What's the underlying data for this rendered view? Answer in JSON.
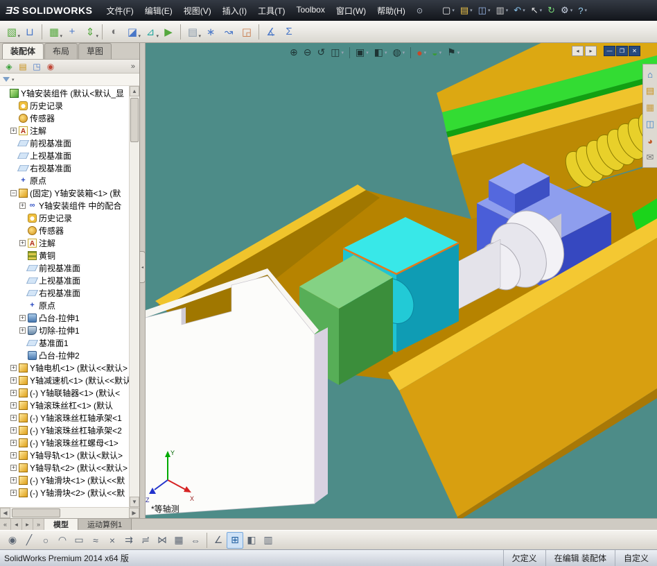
{
  "colors": {
    "viewport_bg": "#4D8C88",
    "channel_gold": "#D89F10",
    "rail_green": "#33DC33",
    "bearing_blue": "#4A5ED8",
    "slide_cyan": "#1FC3D3",
    "motor_green": "#57AE57",
    "titlebar_dark": "#12151B"
  },
  "titlebar": {
    "logo_mark": "ƎS",
    "logo_text": "SOLIDWORKS",
    "pin_glyph": "⊙",
    "menus": [
      "文件(F)",
      "编辑(E)",
      "视图(V)",
      "插入(I)",
      "工具(T)",
      "Toolbox",
      "窗口(W)",
      "帮助(H)"
    ],
    "tools": [
      {
        "glyph": "▢",
        "name": "new-document",
        "dropdown": true,
        "color": "#f0f0f0"
      },
      {
        "glyph": "▤",
        "name": "open-document",
        "dropdown": true,
        "color": "#e8c048"
      },
      {
        "glyph": "◫",
        "name": "save",
        "dropdown": true,
        "color": "#9ab8e8"
      },
      {
        "glyph": "▥",
        "name": "print",
        "dropdown": true,
        "color": "#cccccc"
      },
      {
        "glyph": "↶",
        "name": "undo",
        "dropdown": true,
        "color": "#88c0e8"
      },
      {
        "glyph": "↖",
        "name": "select",
        "dropdown": true,
        "color": "#e8e8e8"
      },
      {
        "glyph": "↻",
        "name": "rebuild",
        "dropdown": false,
        "color": "#78d878"
      },
      {
        "glyph": "⚙",
        "name": "options",
        "dropdown": true,
        "color": "#cfd8e8"
      },
      {
        "glyph": "?",
        "name": "help",
        "dropdown": true,
        "color": "#9ad0f0"
      }
    ]
  },
  "toolbar": {
    "items": [
      {
        "glyph": "▧",
        "name": "insert-components",
        "dropdown": true,
        "color": "#55a83e"
      },
      {
        "glyph": "⊔",
        "name": "mate",
        "dropdown": false,
        "color": "#4a78c8"
      },
      {
        "sep": true
      },
      {
        "glyph": "▦",
        "name": "linear-component-pattern",
        "dropdown": true,
        "color": "#55a83e"
      },
      {
        "glyph": "+",
        "name": "smart-fasteners",
        "dropdown": false,
        "color": "#4a78c8"
      },
      {
        "glyph": "⇕",
        "name": "move-component",
        "dropdown": true,
        "color": "#55a83e"
      },
      {
        "sep": true
      },
      {
        "glyph": "◐",
        "name": "show-hidden-components",
        "dropdown": false,
        "color": "#777777"
      },
      {
        "glyph": "◪",
        "name": "assembly-features",
        "dropdown": true,
        "color": "#4a78c8"
      },
      {
        "glyph": "⊿",
        "name": "reference-geometry",
        "dropdown": true,
        "color": "#2aa8a0"
      },
      {
        "glyph": "▶",
        "name": "new-motion-study",
        "dropdown": false,
        "color": "#55a83e"
      },
      {
        "sep": true
      },
      {
        "glyph": "▤",
        "name": "bill-of-materials",
        "dropdown": true,
        "color": "#8898a8"
      },
      {
        "glyph": "∗",
        "name": "exploded-view",
        "dropdown": false,
        "color": "#4a78c8"
      },
      {
        "glyph": "↝",
        "name": "explode-line-sketch",
        "dropdown": false,
        "color": "#4a78c8"
      },
      {
        "glyph": "◲",
        "name": "interference-detection",
        "dropdown": false,
        "color": "#c87848"
      },
      {
        "sep": true
      },
      {
        "glyph": "∡",
        "name": "measure",
        "dropdown": false,
        "color": "#4a78c8"
      },
      {
        "glyph": "Σ",
        "name": "mass-properties",
        "dropdown": false,
        "color": "#4a78c8"
      }
    ]
  },
  "command_tabs": [
    {
      "label": "装配体",
      "active": true
    },
    {
      "label": "布局",
      "active": false
    },
    {
      "label": "草图",
      "active": false
    }
  ],
  "panel": {
    "tabs": [
      {
        "glyph": "◈",
        "name": "featuremanager-design-tree",
        "color": "#38a038"
      },
      {
        "glyph": "▤",
        "name": "propertymanager",
        "color": "#c89018"
      },
      {
        "glyph": "◳",
        "name": "configurationmanager",
        "color": "#4878c8"
      },
      {
        "glyph": "◉",
        "name": "dimxpertmanager",
        "color": "#c04838"
      }
    ],
    "more": "»",
    "filter_glyph": "▾",
    "tree": {
      "rows": [
        {
          "label": "Y轴安装组件 (默认<默认_显",
          "icon": "asm",
          "level": 0,
          "exp": ""
        },
        {
          "label": "历史记录",
          "icon": "hist",
          "level": 1,
          "exp": ""
        },
        {
          "label": "传感器",
          "icon": "sensor",
          "level": 1,
          "exp": ""
        },
        {
          "label": "注解",
          "icon": "ann",
          "level": 1,
          "exp": "plus"
        },
        {
          "label": "前视基准面",
          "icon": "plane",
          "level": 1,
          "exp": ""
        },
        {
          "label": "上视基准面",
          "icon": "plane",
          "level": 1,
          "exp": ""
        },
        {
          "label": "右视基准面",
          "icon": "plane",
          "level": 1,
          "exp": ""
        },
        {
          "label": "原点",
          "icon": "origin",
          "level": 1,
          "exp": ""
        },
        {
          "label": "(固定) Y轴安装箱<1> (默",
          "icon": "part",
          "level": 1,
          "exp": "minus"
        },
        {
          "label": "Y轴安装组件 中的配合",
          "icon": "mates",
          "level": 2,
          "exp": "plus"
        },
        {
          "label": "历史记录",
          "icon": "hist",
          "level": 2,
          "exp": ""
        },
        {
          "label": "传感器",
          "icon": "sensor",
          "level": 2,
          "exp": ""
        },
        {
          "label": "注解",
          "icon": "ann",
          "level": 2,
          "exp": "plus"
        },
        {
          "label": "黄铜",
          "icon": "mat",
          "level": 2,
          "exp": ""
        },
        {
          "label": "前视基准面",
          "icon": "plane",
          "level": 2,
          "exp": ""
        },
        {
          "label": "上视基准面",
          "icon": "plane",
          "level": 2,
          "exp": ""
        },
        {
          "label": "右视基准面",
          "icon": "plane",
          "level": 2,
          "exp": ""
        },
        {
          "label": "原点",
          "icon": "origin",
          "level": 2,
          "exp": ""
        },
        {
          "label": "凸台-拉伸1",
          "icon": "boss",
          "level": 2,
          "exp": "plus"
        },
        {
          "label": "切除-拉伸1",
          "icon": "cut",
          "level": 2,
          "exp": "plus"
        },
        {
          "label": "基准面1",
          "icon": "plane",
          "level": 2,
          "exp": ""
        },
        {
          "label": "凸台-拉伸2",
          "icon": "boss",
          "level": 2,
          "exp": ""
        },
        {
          "label": "Y轴电机<1> (默认<<默认>",
          "icon": "part",
          "level": 1,
          "exp": "plus"
        },
        {
          "label": "Y轴减速机<1> (默认<<默认",
          "icon": "part",
          "level": 1,
          "exp": "plus"
        },
        {
          "label": "(-) Y轴联轴器<1> (默认<",
          "icon": "part",
          "level": 1,
          "exp": "plus"
        },
        {
          "label": "Y轴滚珠丝杠<1> (默认",
          "icon": "part",
          "level": 1,
          "exp": "plus"
        },
        {
          "label": "(-) Y轴滚珠丝杠轴承架<1",
          "icon": "part",
          "level": 1,
          "exp": "plus"
        },
        {
          "label": "(-) Y轴滚珠丝杠轴承架<2",
          "icon": "part",
          "level": 1,
          "exp": "plus"
        },
        {
          "label": "(-) Y轴滚珠丝杠螺母<1>",
          "icon": "part",
          "level": 1,
          "exp": "plus"
        },
        {
          "label": "Y轴导轨<1> (默认<默认>",
          "icon": "part",
          "level": 1,
          "exp": "plus"
        },
        {
          "label": "Y轴导轨<2> (默认<<默认>",
          "icon": "part",
          "level": 1,
          "exp": "plus"
        },
        {
          "label": "(-) Y轴滑块<1> (默认<<默",
          "icon": "part",
          "level": 1,
          "exp": "plus"
        },
        {
          "label": "(-) Y轴滑块<2> (默认<<默",
          "icon": "part",
          "level": 1,
          "exp": "plus"
        }
      ]
    }
  },
  "viewport": {
    "view_label": "*等轴测",
    "triad": {
      "x": "X",
      "y": "Y",
      "z": "Z"
    },
    "headsup": [
      {
        "glyph": "⊕",
        "name": "zoom-to-fit"
      },
      {
        "glyph": "⊖",
        "name": "zoom-to-area"
      },
      {
        "glyph": "↺",
        "name": "previous-view"
      },
      {
        "glyph": "◫",
        "name": "section-view",
        "dd": true
      },
      {
        "sep": true
      },
      {
        "glyph": "▣",
        "name": "view-orientation",
        "dd": true
      },
      {
        "glyph": "◧",
        "name": "display-style",
        "dd": true
      },
      {
        "glyph": "◍",
        "name": "hide-show-items",
        "dd": true
      },
      {
        "sep": true
      },
      {
        "glyph": "●",
        "name": "edit-appearance",
        "color": "#c84828",
        "dd": true
      },
      {
        "glyph": "◒",
        "name": "apply-scene",
        "color": "#3a9a3a",
        "dd": true
      },
      {
        "glyph": "⚑",
        "name": "view-settings",
        "dd": true
      }
    ],
    "win_nav": [
      {
        "glyph": "◂",
        "name": "previous-window"
      },
      {
        "glyph": "▸",
        "name": "next-window"
      }
    ],
    "win_buttons": [
      {
        "glyph": "—",
        "name": "minimize-window"
      },
      {
        "glyph": "❐",
        "name": "restore-window"
      },
      {
        "glyph": "✕",
        "name": "close-window"
      }
    ],
    "task_pane": [
      {
        "glyph": "⌂",
        "name": "solidworks-resources",
        "color": "#2a6fc0"
      },
      {
        "glyph": "▤",
        "name": "design-library",
        "color": "#c89018"
      },
      {
        "glyph": "▦",
        "name": "file-explorer",
        "color": "#caa048"
      },
      {
        "glyph": "◫",
        "name": "view-palette",
        "color": "#4888c8"
      },
      {
        "glyph": "◕",
        "name": "appearances-scenes",
        "color": "#c05828"
      },
      {
        "glyph": "✉",
        "name": "custom-properties",
        "color": "#777777"
      }
    ]
  },
  "doc_tabs": {
    "nav": [
      "«",
      "◂",
      "▸",
      "»"
    ],
    "tabs": [
      {
        "label": "模型",
        "active": true
      },
      {
        "label": "运动算例1",
        "active": false
      }
    ]
  },
  "sketchbar": {
    "items": [
      {
        "glyph": "◉",
        "name": "smart-dimension"
      },
      {
        "glyph": "╱",
        "name": "line"
      },
      {
        "glyph": "○",
        "name": "circle"
      },
      {
        "glyph": "◠",
        "name": "centerpoint-arc"
      },
      {
        "glyph": "▭",
        "name": "corner-rectangle"
      },
      {
        "glyph": "≈",
        "name": "spline"
      },
      {
        "glyph": "×",
        "name": "trim-entities"
      },
      {
        "glyph": "⇉",
        "name": "convert-entities"
      },
      {
        "glyph": "≓",
        "name": "offset-entities"
      },
      {
        "glyph": "⋈",
        "name": "mirror-entities"
      },
      {
        "glyph": "▦",
        "name": "linear-sketch-pattern"
      },
      {
        "glyph": "⇔",
        "name": "move-entities"
      },
      {
        "sep": true
      },
      {
        "glyph": "∠",
        "name": "sketch-snaps"
      },
      {
        "glyph": "⊞",
        "name": "grid-system",
        "pressed": true
      },
      {
        "glyph": "◧",
        "name": "instant-2d"
      },
      {
        "glyph": "▥",
        "name": "units"
      }
    ]
  },
  "statusbar": {
    "left": "SolidWorks Premium 2014 x64 版",
    "cells": [
      "欠定义",
      "在编辑 装配体",
      "自定义"
    ]
  }
}
